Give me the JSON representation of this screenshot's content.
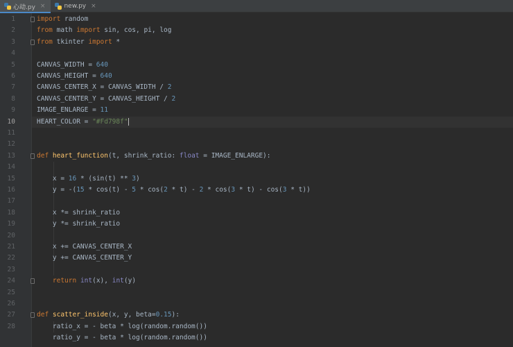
{
  "tabs": [
    {
      "label": "心动.py",
      "active": true
    },
    {
      "label": "new.py",
      "active": false
    }
  ],
  "editor": {
    "current_line": 10,
    "line_numbers": [
      "1",
      "2",
      "3",
      "4",
      "5",
      "6",
      "7",
      "8",
      "9",
      "10",
      "11",
      "12",
      "13",
      "14",
      "15",
      "16",
      "17",
      "18",
      "19",
      "20",
      "21",
      "22",
      "23",
      "24",
      "25",
      "26",
      "27",
      "28"
    ],
    "lines": [
      [
        {
          "t": "import",
          "c": "kw"
        },
        {
          "t": " random",
          "c": ""
        }
      ],
      [
        {
          "t": "from",
          "c": "kw"
        },
        {
          "t": " math ",
          "c": ""
        },
        {
          "t": "import",
          "c": "kw"
        },
        {
          "t": " sin, cos, pi, log",
          "c": ""
        }
      ],
      [
        {
          "t": "from",
          "c": "kw"
        },
        {
          "t": " tkinter ",
          "c": ""
        },
        {
          "t": "import",
          "c": "kw"
        },
        {
          "t": " *",
          "c": ""
        }
      ],
      [],
      [
        {
          "t": "CANVAS_WIDTH = ",
          "c": ""
        },
        {
          "t": "640",
          "c": "num"
        }
      ],
      [
        {
          "t": "CANVAS_HEIGHT = ",
          "c": ""
        },
        {
          "t": "640",
          "c": "num"
        }
      ],
      [
        {
          "t": "CANVAS_CENTER_X = CANVAS_WIDTH / ",
          "c": ""
        },
        {
          "t": "2",
          "c": "num"
        }
      ],
      [
        {
          "t": "CANVAS_CENTER_Y = CANVAS_HEIGHT / ",
          "c": ""
        },
        {
          "t": "2",
          "c": "num"
        }
      ],
      [
        {
          "t": "IMAGE_ENLARGE = ",
          "c": ""
        },
        {
          "t": "11",
          "c": "num"
        }
      ],
      [
        {
          "t": "HEART_COLOR = ",
          "c": ""
        },
        {
          "t": "\"#Fd798f\"",
          "c": "str"
        }
      ],
      [],
      [],
      [
        {
          "t": "def ",
          "c": "kw"
        },
        {
          "t": "heart_function",
          "c": "fn"
        },
        {
          "t": "(t, shrink_ratio: ",
          "c": ""
        },
        {
          "t": "float",
          "c": "builtin"
        },
        {
          "t": " = IMAGE_ENLARGE):",
          "c": ""
        }
      ],
      [],
      [
        {
          "t": "    x = ",
          "c": ""
        },
        {
          "t": "16",
          "c": "num"
        },
        {
          "t": " * (sin(t) ** ",
          "c": ""
        },
        {
          "t": "3",
          "c": "num"
        },
        {
          "t": ")",
          "c": ""
        }
      ],
      [
        {
          "t": "    y = -(",
          "c": ""
        },
        {
          "t": "15",
          "c": "num"
        },
        {
          "t": " * cos(t) - ",
          "c": ""
        },
        {
          "t": "5",
          "c": "num"
        },
        {
          "t": " * cos(",
          "c": ""
        },
        {
          "t": "2",
          "c": "num"
        },
        {
          "t": " * t) - ",
          "c": ""
        },
        {
          "t": "2",
          "c": "num"
        },
        {
          "t": " * cos(",
          "c": ""
        },
        {
          "t": "3",
          "c": "num"
        },
        {
          "t": " * t) - cos(",
          "c": ""
        },
        {
          "t": "3",
          "c": "num"
        },
        {
          "t": " * t))",
          "c": ""
        }
      ],
      [],
      [
        {
          "t": "    x *= shrink_ratio",
          "c": ""
        }
      ],
      [
        {
          "t": "    y *= shrink_ratio",
          "c": ""
        }
      ],
      [],
      [
        {
          "t": "    x += CANVAS_CENTER_X",
          "c": ""
        }
      ],
      [
        {
          "t": "    y += CANVAS_CENTER_Y",
          "c": ""
        }
      ],
      [],
      [
        {
          "t": "    ",
          "c": ""
        },
        {
          "t": "return ",
          "c": "kw"
        },
        {
          "t": "int",
          "c": "builtin"
        },
        {
          "t": "(x), ",
          "c": ""
        },
        {
          "t": "int",
          "c": "builtin"
        },
        {
          "t": "(y)",
          "c": ""
        }
      ],
      [],
      [],
      [
        {
          "t": "def ",
          "c": "kw"
        },
        {
          "t": "scatter_inside",
          "c": "fn"
        },
        {
          "t": "(x, y, beta=",
          "c": ""
        },
        {
          "t": "0.15",
          "c": "num"
        },
        {
          "t": "):",
          "c": ""
        }
      ],
      [
        {
          "t": "    ratio_x = - beta * log(random.random())",
          "c": ""
        }
      ],
      [
        {
          "t": "    ratio_y = - beta * log(random.random())",
          "c": ""
        }
      ]
    ]
  }
}
